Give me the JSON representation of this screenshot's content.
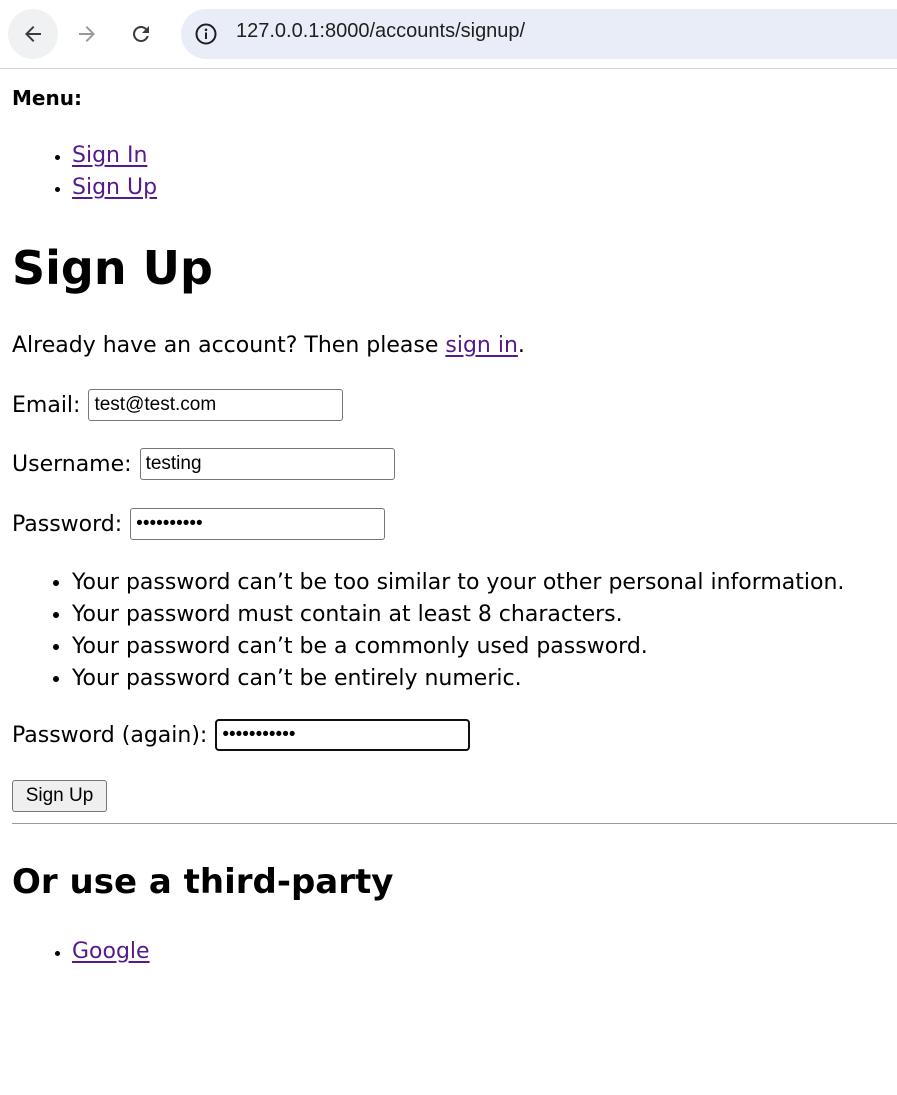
{
  "browser": {
    "url": "127.0.0.1:8000/accounts/signup/",
    "back_icon": "arrow-left-icon",
    "forward_icon": "arrow-right-icon",
    "reload_icon": "reload-icon",
    "site_info_icon": "info-icon"
  },
  "menu": {
    "label": "Menu:",
    "items": [
      {
        "label": "Sign In"
      },
      {
        "label": "Sign Up"
      }
    ]
  },
  "form": {
    "title": "Sign Up",
    "already_text": "Already have an account? Then please ",
    "sign_in_link": "sign in",
    "already_suffix": ".",
    "email_label": "Email:",
    "email_value": "test@test.com",
    "username_label": "Username:",
    "username_value": "testing",
    "password_label": "Password:",
    "password_value": "••••••••••",
    "password_help": [
      "Your password can’t be too similar to your other personal information.",
      "Your password must contain at least 8 characters.",
      "Your password can’t be a commonly used password.",
      "Your password can’t be entirely numeric."
    ],
    "password2_label": "Password (again):",
    "password2_value": "•••••••••••",
    "submit_label": "Sign Up"
  },
  "third_party": {
    "heading": "Or use a third-party",
    "providers": [
      {
        "label": "Google"
      }
    ]
  },
  "colors": {
    "link": "#551a8b",
    "omnibox": "#e9edf7"
  }
}
